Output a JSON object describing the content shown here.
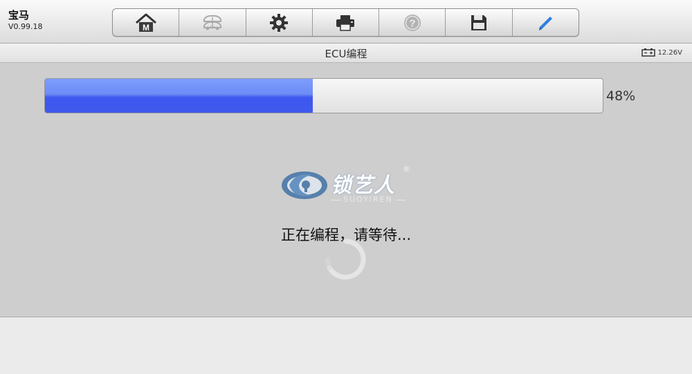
{
  "vehicle": {
    "make": "宝马",
    "version": "V0.99.18"
  },
  "toolbar": {
    "buttons": [
      {
        "icon": "home-icon"
      },
      {
        "icon": "vehicle-swap-icon"
      },
      {
        "icon": "gear-icon"
      },
      {
        "icon": "printer-icon"
      },
      {
        "icon": "help-icon"
      },
      {
        "icon": "save-icon"
      },
      {
        "icon": "pencil-icon"
      }
    ]
  },
  "title": "ECU编程",
  "battery": {
    "voltage": "12.26V"
  },
  "progress": {
    "percent_label": "48%",
    "fraction": 0.48
  },
  "watermark": {
    "brand": "锁艺人",
    "registered": "®",
    "subtitle": "SUOYIREN"
  },
  "status": {
    "message": "正在编程，请等待..."
  },
  "colors": {
    "progress_fill": "#4059ec",
    "pencil_accent": "#2f7fe0"
  }
}
